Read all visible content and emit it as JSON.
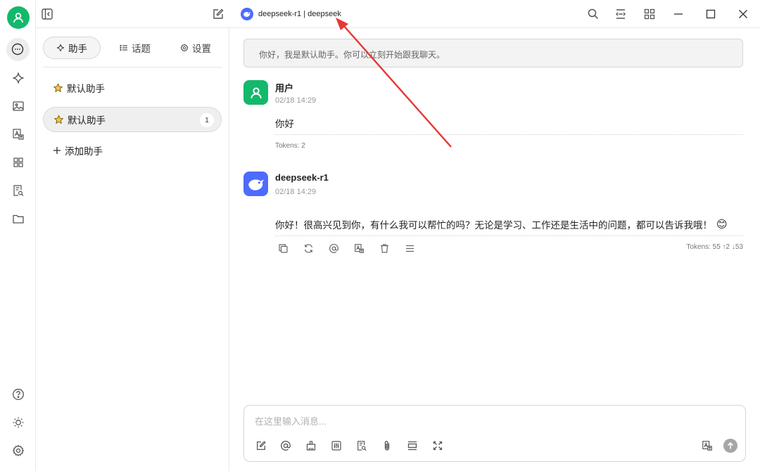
{
  "window": {
    "model_label": "deepseek-r1 | deepseek"
  },
  "sidebar_rail": {
    "items": [
      {
        "icon": "chat-icon",
        "active": true
      },
      {
        "icon": "sparkle-icon"
      },
      {
        "icon": "image-icon"
      },
      {
        "icon": "translate-icon"
      },
      {
        "icon": "apps-grid-icon"
      },
      {
        "icon": "document-search-icon"
      },
      {
        "icon": "folder-icon"
      }
    ],
    "bottom": [
      {
        "icon": "help-icon"
      },
      {
        "icon": "theme-sun-icon"
      },
      {
        "icon": "settings-gear-icon"
      }
    ]
  },
  "panel": {
    "tabs": [
      {
        "label": "助手",
        "icon": "sparkle-icon",
        "active": true
      },
      {
        "label": "话题",
        "icon": "list-icon"
      },
      {
        "label": "设置",
        "icon": "gear-icon"
      }
    ],
    "assistants": [
      {
        "name": "默认助手",
        "icon": "star-icon"
      },
      {
        "name": "默认助手",
        "icon": "star-icon",
        "selected": true,
        "badge": "1"
      }
    ],
    "add_label": "添加助手"
  },
  "chat": {
    "system_prompt": "你好，我是默认助手。你可以立刻开始跟我聊天。",
    "messages": [
      {
        "sender": "用户",
        "time": "02/18 14:29",
        "content": "你好",
        "tokens": "Tokens: 2"
      },
      {
        "sender": "deepseek-r1",
        "time": "02/18 14:29",
        "content": "你好！很高兴见到你，有什么我可以帮忙的吗？无论是学习、工作还是生活中的问题，都可以告诉我哦！",
        "emoji": "😊",
        "tokens": "Tokens: 55 ↑2 ↓53"
      }
    ],
    "input_placeholder": "在这里输入消息..."
  },
  "colors": {
    "user_avatar": "#14b86b",
    "deepseek_brand": "#4d6bfe",
    "annotation_arrow": "#e53935"
  }
}
